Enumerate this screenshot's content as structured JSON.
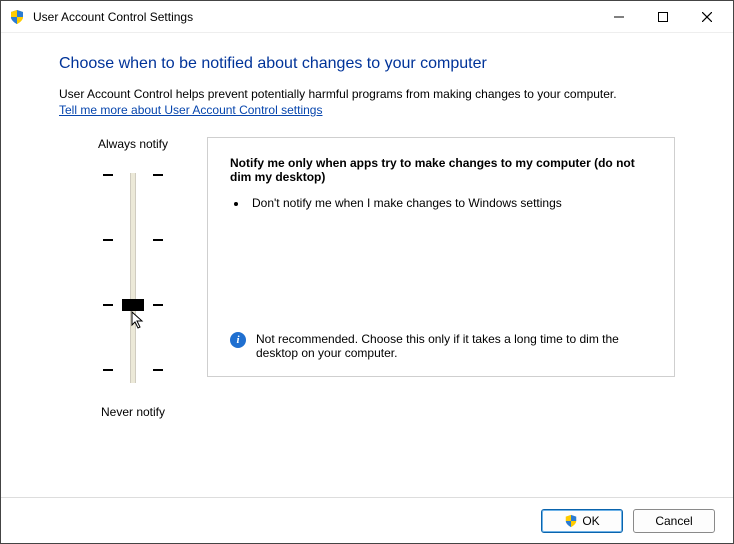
{
  "window": {
    "title": "User Account Control Settings"
  },
  "main": {
    "heading": "Choose when to be notified about changes to your computer",
    "description": "User Account Control helps prevent potentially harmful programs from making changes to your computer.",
    "link_text": "Tell me more about User Account Control settings"
  },
  "slider": {
    "top_label": "Always notify",
    "bottom_label": "Never notify"
  },
  "info": {
    "title": "Notify me only when apps try to make changes to my computer (do not dim my desktop)",
    "bullet1": "Don't notify me when I make changes to Windows settings",
    "note": "Not recommended. Choose this only if it takes a long time to dim the desktop on your computer."
  },
  "footer": {
    "ok": "OK",
    "cancel": "Cancel"
  }
}
